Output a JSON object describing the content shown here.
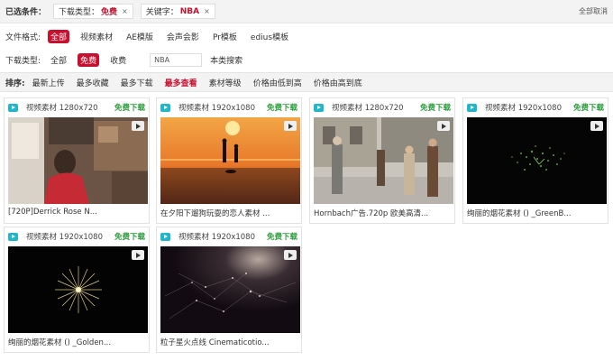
{
  "filter_bar": {
    "label": "已选条件：",
    "chips": [
      {
        "key": "下载类型：",
        "value": "免费",
        "close": "×"
      },
      {
        "key": "关键字：",
        "value": "NBA",
        "close": "×"
      }
    ],
    "clear_all": "全部取消"
  },
  "file_format": {
    "label": "文件格式:",
    "options": [
      "全部",
      "视频素材",
      "AE模版",
      "会声会影",
      "Pr模板",
      "edius模板"
    ],
    "active_index": 0
  },
  "download_type": {
    "label": "下载类型:",
    "options": [
      "全部",
      "免费",
      "收费"
    ],
    "active_index": 1,
    "keyword_value": "NBA",
    "search_label": "本类搜索"
  },
  "sort_bar": {
    "label": "排序:",
    "options": [
      "最新上传",
      "最多收藏",
      "最多下载",
      "最多查看",
      "素材等级",
      "价格由低到高",
      "价格由高到底"
    ],
    "active_index": 3
  },
  "cards": [
    {
      "meta": "视频素材 1280x720",
      "download": "免费下载",
      "title": "[720P]Derrick Rose N..."
    },
    {
      "meta": "视频素材 1920x1080",
      "download": "免费下载",
      "title": "在夕阳下遛狗玩耍的恋人素材 ..."
    },
    {
      "meta": "视频素材 1280x720",
      "download": "免费下载",
      "title": "Hornbach广告.720p 欧美高清..."
    },
    {
      "meta": "视频素材 1920x1080",
      "download": "免费下载",
      "title": "绚丽的烟花素材 () _GreenB..."
    },
    {
      "meta": "视频素材 1920x1080",
      "download": "免费下载",
      "title": "绚丽的烟花素材 () _Golden..."
    },
    {
      "meta": "视频素材 1920x1080",
      "download": "免费下载",
      "title": "粒子星火点线 Cinematicotio..."
    }
  ],
  "colors": {
    "accent": "#c8102e",
    "download": "#2a9d3a",
    "video_icon": "#1fb7c9"
  }
}
